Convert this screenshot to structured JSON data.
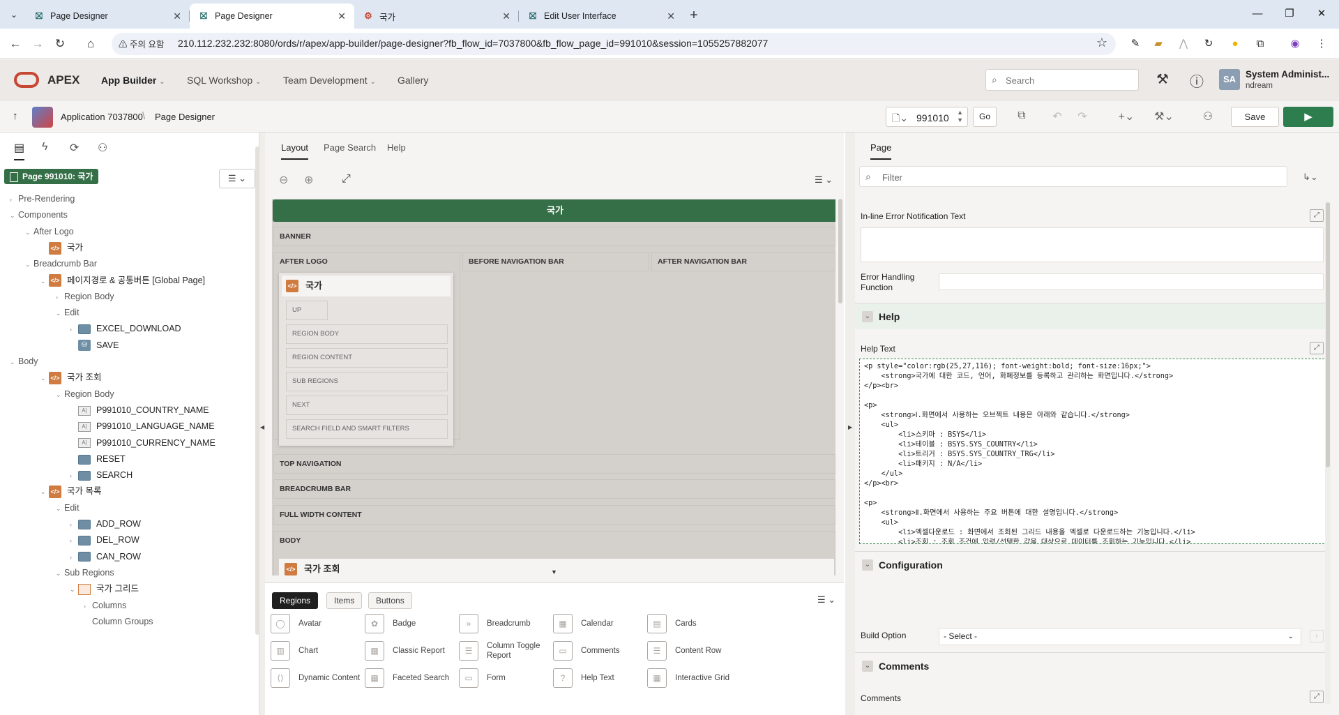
{
  "browser": {
    "tabs": [
      {
        "title": "Page Designer",
        "active": false
      },
      {
        "title": "Page Designer",
        "active": true
      },
      {
        "title": "국가",
        "active": false
      },
      {
        "title": "Edit User Interface",
        "active": false
      }
    ],
    "security_warning": "⚠ 주의 요함",
    "url": "210.112.232.232:8080/ords/r/apex/app-builder/page-designer?fb_flow_id=7037800&fb_flow_page_id=991010&session=1055257882077"
  },
  "apex_header": {
    "brand": "APEX",
    "nav": [
      "App Builder",
      "SQL Workshop",
      "Team Development",
      "Gallery"
    ],
    "search_placeholder": "Search",
    "user_initials": "SA",
    "user_name": "System Administ...",
    "user_workspace": "ndream"
  },
  "page_designer_bar": {
    "breadcrumb_app": "Application 7037800",
    "breadcrumb_sep": "\\",
    "breadcrumb_page": "Page Designer",
    "page_number": "991010",
    "go_label": "Go",
    "save_label": "Save"
  },
  "left_panel": {
    "page_badge": "Page 991010: 국가",
    "tree": [
      {
        "label": "Pre-Rendering",
        "depth": 0,
        "icon": "none",
        "caret": "›",
        "grey": true
      },
      {
        "label": "Components",
        "depth": 0,
        "icon": "none",
        "caret": "⌄",
        "grey": true
      },
      {
        "label": "After Logo",
        "depth": 1,
        "icon": "none",
        "caret": "⌄",
        "grey": true
      },
      {
        "label": "국가",
        "depth": 2,
        "icon": "region",
        "caret": "",
        "grey": false
      },
      {
        "label": "Breadcrumb Bar",
        "depth": 1,
        "icon": "none",
        "caret": "⌄",
        "grey": true
      },
      {
        "label": "페이지경로 & 공통버튼 [Global Page]",
        "depth": 2,
        "icon": "region",
        "caret": "⌄",
        "grey": false
      },
      {
        "label": "Region Body",
        "depth": 3,
        "icon": "none",
        "caret": "›",
        "grey": true
      },
      {
        "label": "Edit",
        "depth": 3,
        "icon": "none",
        "caret": "⌄",
        "grey": true
      },
      {
        "label": "EXCEL_DOWNLOAD",
        "depth": 4,
        "icon": "button",
        "caret": "›",
        "grey": false
      },
      {
        "label": "SAVE",
        "depth": 4,
        "icon": "save",
        "caret": "",
        "grey": false
      },
      {
        "label": "Body",
        "depth": 0,
        "icon": "none",
        "caret": "⌄",
        "grey": true
      },
      {
        "label": "국가 조회",
        "depth": 2,
        "icon": "region",
        "caret": "⌄",
        "grey": false
      },
      {
        "label": "Region Body",
        "depth": 3,
        "icon": "none",
        "caret": "⌄",
        "grey": true
      },
      {
        "label": "P991010_COUNTRY_NAME",
        "depth": 4,
        "icon": "item",
        "caret": "",
        "grey": false
      },
      {
        "label": "P991010_LANGUAGE_NAME",
        "depth": 4,
        "icon": "item",
        "caret": "",
        "grey": false
      },
      {
        "label": "P991010_CURRENCY_NAME",
        "depth": 4,
        "icon": "item",
        "caret": "",
        "grey": false
      },
      {
        "label": "RESET",
        "depth": 4,
        "icon": "button",
        "caret": "",
        "grey": false
      },
      {
        "label": "SEARCH",
        "depth": 4,
        "icon": "button",
        "caret": "›",
        "grey": false
      },
      {
        "label": "국가 목록",
        "depth": 2,
        "icon": "region",
        "caret": "⌄",
        "grey": false
      },
      {
        "label": "Edit",
        "depth": 3,
        "icon": "none",
        "caret": "⌄",
        "grey": true
      },
      {
        "label": "ADD_ROW",
        "depth": 4,
        "icon": "button",
        "caret": "›",
        "grey": false
      },
      {
        "label": "DEL_ROW",
        "depth": 4,
        "icon": "button",
        "caret": "›",
        "grey": false
      },
      {
        "label": "CAN_ROW",
        "depth": 4,
        "icon": "button",
        "caret": "›",
        "grey": false
      },
      {
        "label": "Sub Regions",
        "depth": 3,
        "icon": "none",
        "caret": "⌄",
        "grey": true
      },
      {
        "label": "국가 그리드",
        "depth": 4,
        "icon": "grid",
        "caret": "⌄",
        "grey": false
      },
      {
        "label": "Columns",
        "depth": 5,
        "icon": "none",
        "caret": "›",
        "grey": true
      },
      {
        "label": "Column Groups",
        "depth": 5,
        "icon": "none",
        "caret": "",
        "grey": true
      }
    ]
  },
  "center_panel": {
    "tabs": [
      "Layout",
      "Page Search",
      "Help"
    ],
    "page_title": "국가",
    "slots": {
      "banner": "BANNER",
      "after_logo": "AFTER LOGO",
      "before_nav": "BEFORE NAVIGATION BAR",
      "after_nav": "AFTER NAVIGATION BAR",
      "top_nav": "TOP NAVIGATION",
      "breadcrumb_bar": "BREADCRUMB BAR",
      "full_width": "FULL WIDTH CONTENT",
      "body": "BODY"
    },
    "region_title": "국가",
    "region_slots": [
      "UP",
      "REGION BODY",
      "REGION CONTENT",
      "SUB REGIONS",
      "NEXT",
      "SEARCH FIELD AND SMART FILTERS"
    ],
    "body_region": "국가 조회",
    "gallery_tabs": [
      "Regions",
      "Items",
      "Buttons"
    ],
    "gallery_items": [
      {
        "label": "Avatar",
        "icon": "◯"
      },
      {
        "label": "Badge",
        "icon": "✿"
      },
      {
        "label": "Breadcrumb",
        "icon": "»"
      },
      {
        "label": "Calendar",
        "icon": "▦"
      },
      {
        "label": "Cards",
        "icon": "▤"
      },
      {
        "label": "Chart",
        "icon": "▥"
      },
      {
        "label": "Classic Report",
        "icon": "▦"
      },
      {
        "label": "Column Toggle Report",
        "icon": "☰"
      },
      {
        "label": "Comments",
        "icon": "▭"
      },
      {
        "label": "Content Row",
        "icon": "☰"
      },
      {
        "label": "Dynamic Content",
        "icon": "⟨⟩"
      },
      {
        "label": "Faceted Search",
        "icon": "▦"
      },
      {
        "label": "Form",
        "icon": "▭"
      },
      {
        "label": "Help Text",
        "icon": "?"
      },
      {
        "label": "Interactive Grid",
        "icon": "▦"
      }
    ]
  },
  "right_panel": {
    "tab": "Page",
    "filter_placeholder": "Filter",
    "inline_error_label": "In-line Error Notification Text",
    "error_handling_label": "Error Handling Function",
    "help_section": "Help",
    "help_text_label": "Help Text",
    "help_text": "<p style=\"color:rgb(25,27,116); font-weight:bold; font-size:16px;\">\n    <strong>국가에 대한 코드, 언어, 화폐정보를 등록하고 관리하는 화면입니다.</strong>\n</p><br>\n\n<p>\n    <strong>Ⅰ.화면에서 사용하는 오브젝트 내용은 아래와 같습니다.</strong>\n    <ul>\n        <li>스키마 : BSYS</li>\n        <li>테이블 : BSYS.SYS_COUNTRY</li>\n        <li>트리거 : BSYS.SYS_COUNTRY_TRG</li>\n        <li>패키지 : N/A</li>\n    </ul>\n</p><br>\n\n<p>\n    <strong>Ⅱ.화면에서 사용하는 주요 버튼에 대한 설명입니다.</strong>\n    <ul>\n        <li>엑셀다운로드 : 화면에서 조회된 그리드 내용을 엑셀로 다운로드하는 기능입니다.</li>\n        <li>조회 : 조회 조건에 입력/선택한 값을 대상으로 데이터를 조회하는 기능입니다.</li>\n        <li>초기화 : 메뉴를 클릭할 시 화면 오픈된 내용과 동일하게 초기 값을 설정하는 기능입니다.</li>\n        <li>행추가 : 그리드에 신규 값을 입력하기 위하여 행을 추가합니다.</li>\n        <li>행삭제 : 그리드에서 선택한 행을 삭제합니다. 단, 저장 버튼을 클릭할 시 데이터는 삭제됩니다.</li>\n        <li>행취소 : 그리드에서 삭제를 취소한 내용을 취소하기 위한 기능입니다.</li>",
    "config_section": "Configuration",
    "build_option_label": "Build Option",
    "build_option_value": "- Select -",
    "comments_section": "Comments",
    "comments_label": "Comments"
  }
}
